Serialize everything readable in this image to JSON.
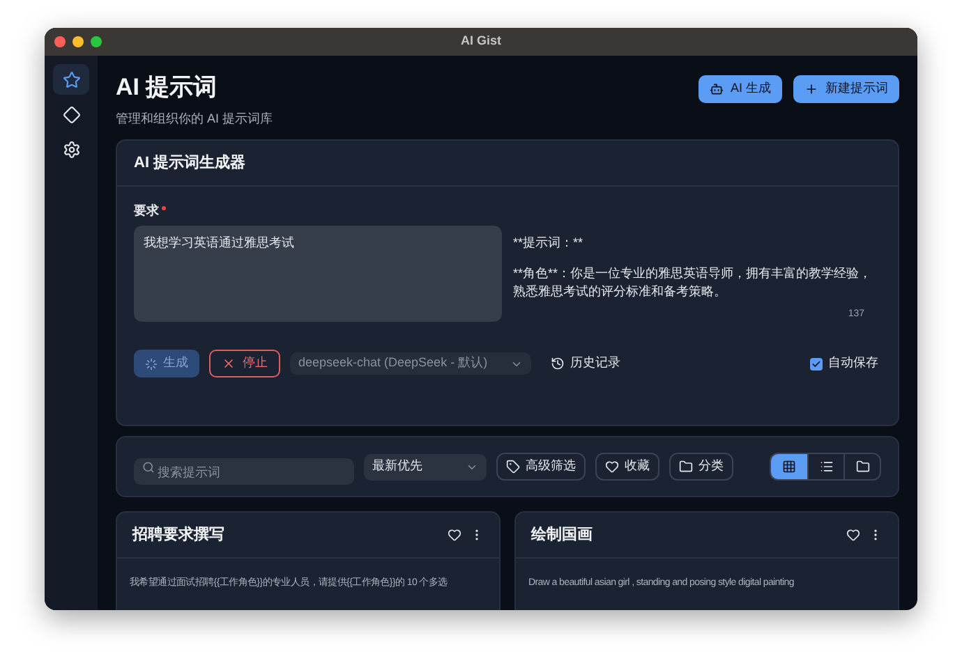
{
  "window": {
    "title": "AI Gist"
  },
  "sidebar": {
    "items": [
      {
        "kind": "star",
        "selected": true
      },
      {
        "kind": "diamond",
        "selected": false
      },
      {
        "kind": "gear",
        "selected": false
      }
    ]
  },
  "header": {
    "title": "AI 提示词",
    "subtitle": "管理和组织你的 AI 提示词库",
    "actions": [
      {
        "kind": "ai",
        "label": "AI 生成"
      },
      {
        "kind": "add",
        "label": "新建提示词"
      }
    ]
  },
  "generator": {
    "title": "AI 提示词生成器",
    "requirement": {
      "label": "要求",
      "required": true,
      "value": "我想学习英语通过雅思考试"
    },
    "output": [
      "**提示词：**",
      "**角色**：你是一位专业的雅思英语导师，拥有丰富的教学经验，熟悉雅思考试的评分标准和备考策略。"
    ],
    "char_count": "137",
    "generate_button": {
      "label": "生成",
      "loading": true
    },
    "stop_button": {
      "label": "停止"
    },
    "model_select": {
      "value": "deepseek-chat (DeepSeek - 默认)",
      "disabled": true
    },
    "history_button": {
      "label": "历史记录"
    },
    "autosave": {
      "label": "自动保存",
      "checked": true
    }
  },
  "toolbar": {
    "search": {
      "placeholder": "搜索提示词"
    },
    "sort": {
      "value": "最新优先"
    },
    "filters": [
      {
        "kind": "tag",
        "label": "高级筛选"
      },
      {
        "kind": "heart",
        "label": "收藏"
      },
      {
        "kind": "folder",
        "label": "分类"
      }
    ],
    "views": [
      {
        "kind": "grid",
        "selected": true
      },
      {
        "kind": "list",
        "selected": false
      },
      {
        "kind": "folder",
        "selected": false
      }
    ]
  },
  "cards": [
    {
      "title": "招聘要求撰写",
      "favorite": false,
      "description": "我希望通过面试招聘{{工作角色}}的专业人员，请提供{{工作角色}}的 10 个多选"
    },
    {
      "title": "绘制国画",
      "favorite": false,
      "description": "Draw a beautiful asian girl , standing and posing style digital painting"
    }
  ]
}
